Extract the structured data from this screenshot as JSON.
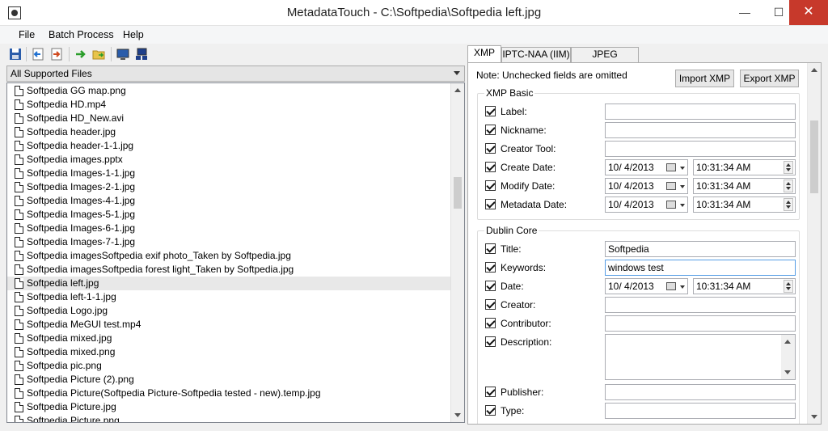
{
  "window": {
    "title": "MetadataTouch - C:\\Softpedia\\Softpedia left.jpg",
    "minimize": "—",
    "maximize": "☐",
    "close": "✕"
  },
  "menu": [
    "File",
    "Batch Process",
    "Help"
  ],
  "toolbar": {
    "icons": [
      "save-icon",
      "back-icon",
      "forward-icon",
      "go-icon",
      "open-folder-icon",
      "monitor-icon",
      "network-icon"
    ]
  },
  "filter": {
    "selected": "All Supported Files"
  },
  "files": [
    "Softpedia GG map.png",
    "Softpedia HD.mp4",
    "Softpedia HD_New.avi",
    "Softpedia header.jpg",
    "Softpedia header-1-1.jpg",
    "Softpedia images.pptx",
    "Softpedia Images-1-1.jpg",
    "Softpedia Images-2-1.jpg",
    "Softpedia Images-4-1.jpg",
    "Softpedia Images-5-1.jpg",
    "Softpedia Images-6-1.jpg",
    "Softpedia Images-7-1.jpg",
    "Softpedia imagesSoftpedia exif photo_Taken by Softpedia.jpg",
    "Softpedia imagesSoftpedia forest light_Taken by Softpedia.jpg",
    "Softpedia left.jpg",
    "Softpedia left-1-1.jpg",
    "Softpedia Logo.jpg",
    "Softpedia MeGUI test.mp4",
    "Softpedia mixed.jpg",
    "Softpedia mixed.png",
    "Softpedia pic.png",
    "Softpedia Picture (2).png",
    "Softpedia Picture(Softpedia Picture-Softpedia tested - new).temp.jpg",
    "Softpedia Picture.jpg",
    "Softpedia Picture.png"
  ],
  "selected_file_index": 14,
  "tabs": [
    "XMP",
    "IPTC-NAA (IIM)",
    "JPEG Comment"
  ],
  "active_tab": 0,
  "panel": {
    "note": "Note: Unchecked fields are omitted",
    "import_button": "Import XMP",
    "export_button": "Export XMP",
    "xmp_basic": {
      "title": "XMP Basic",
      "fields": [
        {
          "label": "Label:",
          "type": "text",
          "value": ""
        },
        {
          "label": "Nickname:",
          "type": "text",
          "value": ""
        },
        {
          "label": "Creator Tool:",
          "type": "text",
          "value": ""
        },
        {
          "label": "Create Date:",
          "type": "datetime",
          "date": "10/  4/2013",
          "time": "10:31:34 AM"
        },
        {
          "label": "Modify Date:",
          "type": "datetime",
          "date": "10/  4/2013",
          "time": "10:31:34 AM"
        },
        {
          "label": "Metadata Date:",
          "type": "datetime",
          "date": "10/  4/2013",
          "time": "10:31:34 AM"
        }
      ]
    },
    "dublin_core": {
      "title": "Dublin Core",
      "fields": [
        {
          "label": "Title:",
          "type": "text",
          "value": "Softpedia"
        },
        {
          "label": "Keywords:",
          "type": "text",
          "value": "windows test"
        },
        {
          "label": "Date:",
          "type": "datetime",
          "date": "10/  4/2013",
          "time": "10:31:34 AM"
        },
        {
          "label": "Creator:",
          "type": "text",
          "value": ""
        },
        {
          "label": "Contributor:",
          "type": "text",
          "value": ""
        },
        {
          "label": "Description:",
          "type": "multiline",
          "value": ""
        },
        {
          "label": "Publisher:",
          "type": "text",
          "value": ""
        },
        {
          "label": "Type:",
          "type": "text",
          "value": ""
        }
      ]
    }
  }
}
